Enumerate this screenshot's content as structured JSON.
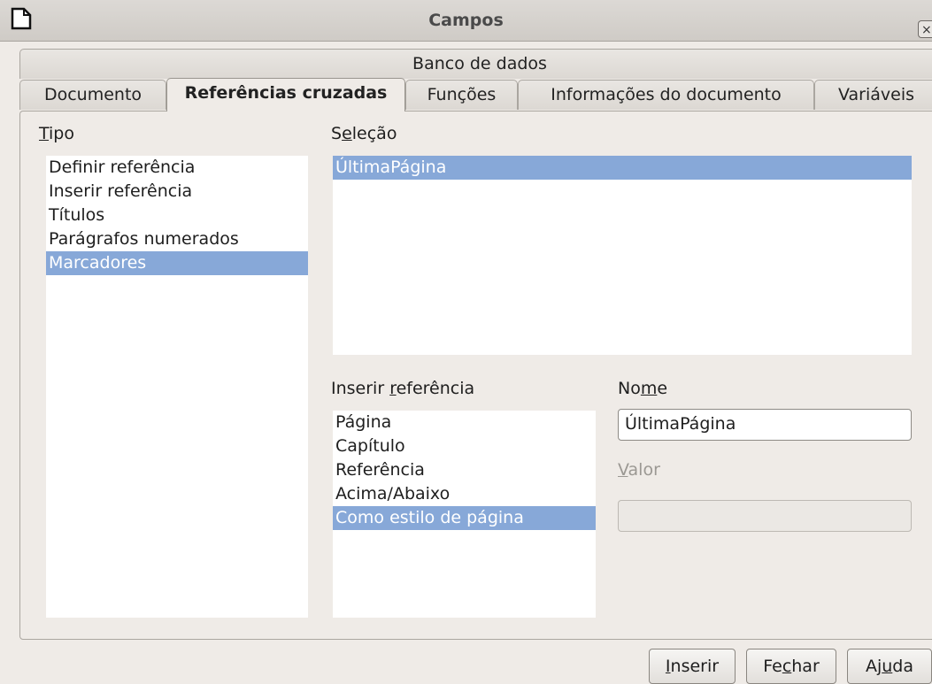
{
  "window": {
    "title": "Campos",
    "close_glyph": "×"
  },
  "tabs": {
    "top_row": [
      "Banco de dados"
    ],
    "bottom_row": [
      "Documento",
      "Referências cruzadas",
      "Funções",
      "Informações do documento",
      "Variáveis"
    ],
    "active": "Referências cruzadas"
  },
  "tipo": {
    "label_u": "T",
    "label_rest": "ipo",
    "items": [
      "Definir referência",
      "Inserir referência",
      "Títulos",
      "Parágrafos numerados",
      "Marcadores"
    ],
    "selected": "Marcadores"
  },
  "selecao": {
    "label_a": "S",
    "label_u": "e",
    "label_rest": "leção",
    "items": [
      "ÚltimaPágina"
    ],
    "selected": "ÚltimaPágina"
  },
  "inserir_ref": {
    "label_a": "Inserir ",
    "label_u": "r",
    "label_rest": "eferência",
    "items": [
      "Página",
      "Capítulo",
      "Referência",
      "Acima/Abaixo",
      "Como estilo de página"
    ],
    "selected": "Como estilo de página"
  },
  "nome": {
    "label_a": "No",
    "label_u": "m",
    "label_rest": "e",
    "value": "ÚltimaPágina"
  },
  "valor": {
    "label_u": "V",
    "label_rest": "alor",
    "value": ""
  },
  "buttons": {
    "inserir": {
      "u": "I",
      "rest": "nserir"
    },
    "fechar": {
      "a": "Fe",
      "u": "c",
      "rest": "har"
    },
    "ajuda": {
      "a": "Aj",
      "u": "u",
      "rest": "da"
    }
  },
  "icons": {
    "app": "document-icon",
    "close": "close-icon"
  },
  "colors": {
    "selection": "#87a8d8",
    "dialog_bg": "#efebe7"
  }
}
